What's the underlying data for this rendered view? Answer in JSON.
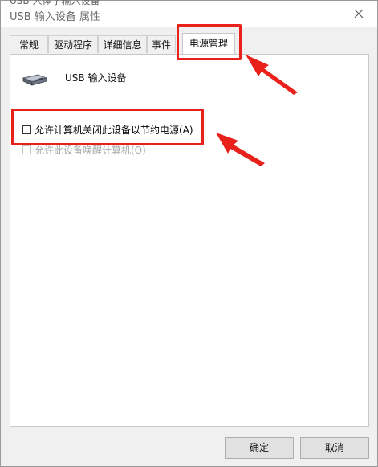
{
  "window": {
    "title_cut": "USB 人体学输入设备",
    "title": "USB 输入设备 属性"
  },
  "tabs": [
    {
      "label": "常规",
      "active": false
    },
    {
      "label": "驱动程序",
      "active": false
    },
    {
      "label": "详细信息",
      "active": false
    },
    {
      "label": "事件",
      "active": false
    },
    {
      "label": "电源管理",
      "active": true
    }
  ],
  "device": {
    "icon": "usb-device-icon",
    "name": "USB 输入设备"
  },
  "power_options": [
    {
      "label": "允许计算机关闭此设备以节约电源(A)",
      "checked": false,
      "enabled": true
    },
    {
      "label": "允许此设备唤醒计算机(O)",
      "checked": false,
      "enabled": false
    }
  ],
  "buttons": {
    "ok": "确定",
    "cancel": "取消"
  },
  "annotation_color": "#e8221a"
}
